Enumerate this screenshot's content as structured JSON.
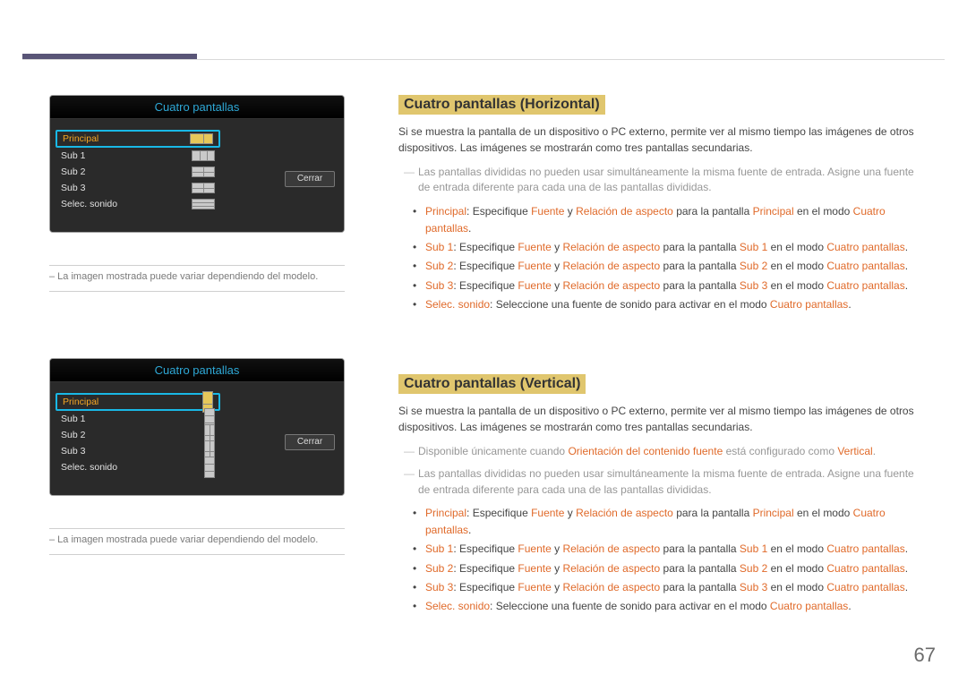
{
  "page_number": "67",
  "osd": {
    "title": "Cuatro pantallas",
    "rows": {
      "principal": "Principal",
      "sub1": "Sub 1",
      "sub2": "Sub 2",
      "sub3": "Sub 3",
      "selec_sonido": "Selec. sonido"
    },
    "close": "Cerrar",
    "caption": "– La imagen mostrada puede variar dependiendo del modelo."
  },
  "section_h": {
    "heading": "Cuatro pantallas (Horizontal)",
    "intro": "Si se muestra la pantalla de un dispositivo o PC externo, permite ver al mismo tiempo las imágenes de otros dispositivos. Las imágenes se mostrarán como tres pantallas secundarias.",
    "note1": "Las pantallas divididas no pueden usar simultáneamente la misma fuente de entrada. Asigne una fuente de entrada diferente para cada una de las pantallas divididas.",
    "bullets": {
      "principal": {
        "k": "Principal",
        "mid": ": Especifique ",
        "f": "Fuente",
        "y": " y ",
        "r": "Relación de aspecto",
        "t": " para la pantalla ",
        "obj": "Principal",
        "t2": " en el modo ",
        "m": "Cuatro pantallas",
        "end": "."
      },
      "sub1": {
        "k": "Sub 1",
        "mid": ": Especifique ",
        "f": "Fuente",
        "y": " y ",
        "r": "Relación de aspecto",
        "t": " para la pantalla ",
        "obj": "Sub 1",
        "t2": " en el modo ",
        "m": "Cuatro pantallas",
        "end": "."
      },
      "sub2": {
        "k": "Sub 2",
        "mid": ": Especifique ",
        "f": "Fuente",
        "y": " y ",
        "r": "Relación de aspecto",
        "t": " para la pantalla ",
        "obj": "Sub 2",
        "t2": " en el modo ",
        "m": "Cuatro pantallas",
        "end": "."
      },
      "sub3": {
        "k": "Sub 3",
        "mid": ": Especifique ",
        "f": "Fuente",
        "y": " y ",
        "r": "Relación de aspecto",
        "t": " para la pantalla ",
        "obj": "Sub 3",
        "t2": " en el modo ",
        "m": "Cuatro pantallas",
        "end": "."
      },
      "selec": {
        "k": "Selec. sonido",
        "mid": ": Seleccione una fuente de sonido para activar en el modo ",
        "m": "Cuatro pantallas",
        "end": "."
      }
    }
  },
  "section_v": {
    "heading": "Cuatro pantallas (Vertical)",
    "intro": "Si se muestra la pantalla de un dispositivo o PC externo, permite ver al mismo tiempo las imágenes de otros dispositivos. Las imágenes se mostrarán como tres pantallas secundarias.",
    "note0_a": "Disponible únicamente cuando ",
    "note0_b": "Orientación del contenido fuente",
    "note0_c": " está configurado como ",
    "note0_d": "Vertical",
    "note0_e": ".",
    "note1": "Las pantallas divididas no pueden usar simultáneamente la misma fuente de entrada. Asigne una fuente de entrada diferente para cada una de las pantallas divididas.",
    "bullets": {
      "principal": {
        "k": "Principal",
        "mid": ": Especifique ",
        "f": "Fuente",
        "y": " y ",
        "r": "Relación de aspecto",
        "t": " para la pantalla ",
        "obj": "Principal",
        "t2": " en el modo ",
        "m": "Cuatro pantallas",
        "end": "."
      },
      "sub1": {
        "k": "Sub 1",
        "mid": ": Especifique ",
        "f": "Fuente",
        "y": " y ",
        "r": "Relación de aspecto",
        "t": " para la pantalla ",
        "obj": "Sub 1",
        "t2": " en el modo ",
        "m": "Cuatro pantallas",
        "end": "."
      },
      "sub2": {
        "k": "Sub 2",
        "mid": ": Especifique ",
        "f": "Fuente",
        "y": " y ",
        "r": "Relación de aspecto",
        "t": " para la pantalla ",
        "obj": "Sub 2",
        "t2": " en el modo ",
        "m": "Cuatro pantallas",
        "end": "."
      },
      "sub3": {
        "k": "Sub 3",
        "mid": ": Especifique ",
        "f": "Fuente",
        "y": " y ",
        "r": "Relación de aspecto",
        "t": " para la pantalla ",
        "obj": "Sub 3",
        "t2": " en el modo ",
        "m": "Cuatro pantallas",
        "end": "."
      },
      "selec": {
        "k": "Selec. sonido",
        "mid": ": Seleccione una fuente de sonido para activar en el modo ",
        "m": "Cuatro pantallas",
        "end": "."
      }
    }
  }
}
